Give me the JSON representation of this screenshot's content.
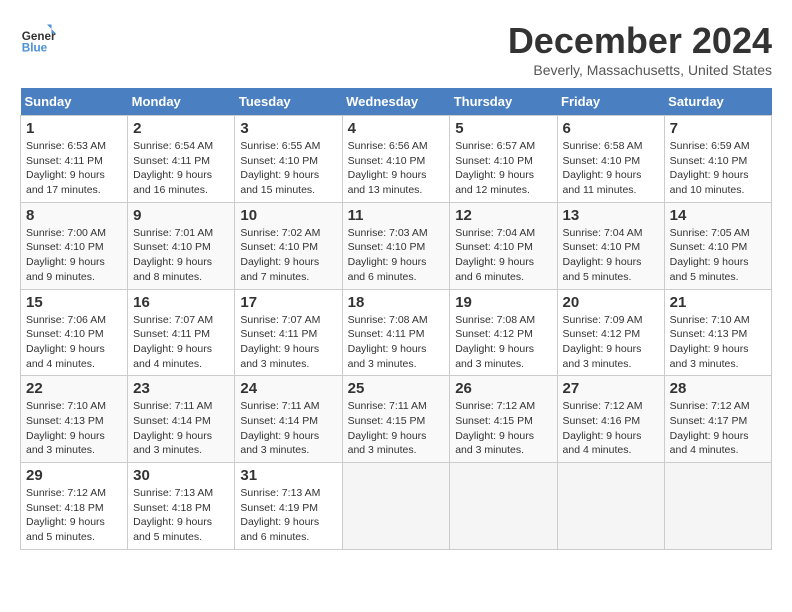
{
  "header": {
    "logo_line1": "General",
    "logo_line2": "Blue",
    "month": "December 2024",
    "location": "Beverly, Massachusetts, United States"
  },
  "weekdays": [
    "Sunday",
    "Monday",
    "Tuesday",
    "Wednesday",
    "Thursday",
    "Friday",
    "Saturday"
  ],
  "weeks": [
    [
      {
        "day": 1,
        "sunrise": "6:53 AM",
        "sunset": "4:11 PM",
        "daylight": "9 hours and 17 minutes."
      },
      {
        "day": 2,
        "sunrise": "6:54 AM",
        "sunset": "4:11 PM",
        "daylight": "9 hours and 16 minutes."
      },
      {
        "day": 3,
        "sunrise": "6:55 AM",
        "sunset": "4:10 PM",
        "daylight": "9 hours and 15 minutes."
      },
      {
        "day": 4,
        "sunrise": "6:56 AM",
        "sunset": "4:10 PM",
        "daylight": "9 hours and 13 minutes."
      },
      {
        "day": 5,
        "sunrise": "6:57 AM",
        "sunset": "4:10 PM",
        "daylight": "9 hours and 12 minutes."
      },
      {
        "day": 6,
        "sunrise": "6:58 AM",
        "sunset": "4:10 PM",
        "daylight": "9 hours and 11 minutes."
      },
      {
        "day": 7,
        "sunrise": "6:59 AM",
        "sunset": "4:10 PM",
        "daylight": "9 hours and 10 minutes."
      }
    ],
    [
      {
        "day": 8,
        "sunrise": "7:00 AM",
        "sunset": "4:10 PM",
        "daylight": "9 hours and 9 minutes."
      },
      {
        "day": 9,
        "sunrise": "7:01 AM",
        "sunset": "4:10 PM",
        "daylight": "9 hours and 8 minutes."
      },
      {
        "day": 10,
        "sunrise": "7:02 AM",
        "sunset": "4:10 PM",
        "daylight": "9 hours and 7 minutes."
      },
      {
        "day": 11,
        "sunrise": "7:03 AM",
        "sunset": "4:10 PM",
        "daylight": "9 hours and 6 minutes."
      },
      {
        "day": 12,
        "sunrise": "7:04 AM",
        "sunset": "4:10 PM",
        "daylight": "9 hours and 6 minutes."
      },
      {
        "day": 13,
        "sunrise": "7:04 AM",
        "sunset": "4:10 PM",
        "daylight": "9 hours and 5 minutes."
      },
      {
        "day": 14,
        "sunrise": "7:05 AM",
        "sunset": "4:10 PM",
        "daylight": "9 hours and 5 minutes."
      }
    ],
    [
      {
        "day": 15,
        "sunrise": "7:06 AM",
        "sunset": "4:10 PM",
        "daylight": "9 hours and 4 minutes."
      },
      {
        "day": 16,
        "sunrise": "7:07 AM",
        "sunset": "4:11 PM",
        "daylight": "9 hours and 4 minutes."
      },
      {
        "day": 17,
        "sunrise": "7:07 AM",
        "sunset": "4:11 PM",
        "daylight": "9 hours and 3 minutes."
      },
      {
        "day": 18,
        "sunrise": "7:08 AM",
        "sunset": "4:11 PM",
        "daylight": "9 hours and 3 minutes."
      },
      {
        "day": 19,
        "sunrise": "7:08 AM",
        "sunset": "4:12 PM",
        "daylight": "9 hours and 3 minutes."
      },
      {
        "day": 20,
        "sunrise": "7:09 AM",
        "sunset": "4:12 PM",
        "daylight": "9 hours and 3 minutes."
      },
      {
        "day": 21,
        "sunrise": "7:10 AM",
        "sunset": "4:13 PM",
        "daylight": "9 hours and 3 minutes."
      }
    ],
    [
      {
        "day": 22,
        "sunrise": "7:10 AM",
        "sunset": "4:13 PM",
        "daylight": "9 hours and 3 minutes."
      },
      {
        "day": 23,
        "sunrise": "7:11 AM",
        "sunset": "4:14 PM",
        "daylight": "9 hours and 3 minutes."
      },
      {
        "day": 24,
        "sunrise": "7:11 AM",
        "sunset": "4:14 PM",
        "daylight": "9 hours and 3 minutes."
      },
      {
        "day": 25,
        "sunrise": "7:11 AM",
        "sunset": "4:15 PM",
        "daylight": "9 hours and 3 minutes."
      },
      {
        "day": 26,
        "sunrise": "7:12 AM",
        "sunset": "4:15 PM",
        "daylight": "9 hours and 3 minutes."
      },
      {
        "day": 27,
        "sunrise": "7:12 AM",
        "sunset": "4:16 PM",
        "daylight": "9 hours and 4 minutes."
      },
      {
        "day": 28,
        "sunrise": "7:12 AM",
        "sunset": "4:17 PM",
        "daylight": "9 hours and 4 minutes."
      }
    ],
    [
      {
        "day": 29,
        "sunrise": "7:12 AM",
        "sunset": "4:18 PM",
        "daylight": "9 hours and 5 minutes."
      },
      {
        "day": 30,
        "sunrise": "7:13 AM",
        "sunset": "4:18 PM",
        "daylight": "9 hours and 5 minutes."
      },
      {
        "day": 31,
        "sunrise": "7:13 AM",
        "sunset": "4:19 PM",
        "daylight": "9 hours and 6 minutes."
      },
      null,
      null,
      null,
      null
    ]
  ]
}
